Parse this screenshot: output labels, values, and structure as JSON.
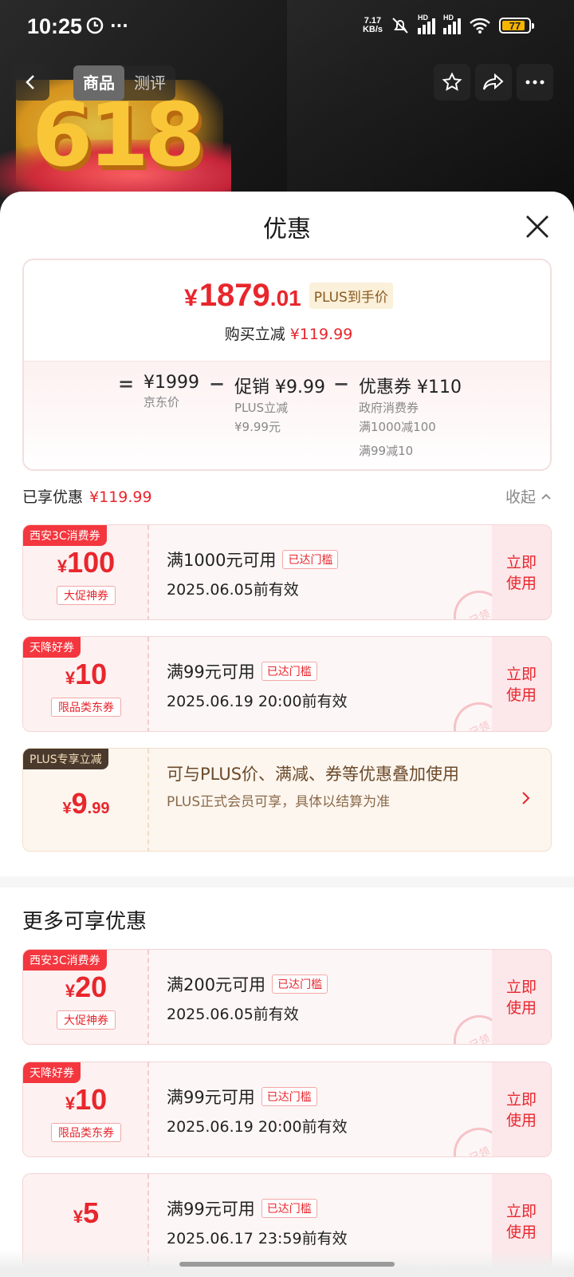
{
  "status": {
    "time": "10:25",
    "net_speed_top": "7.17",
    "net_speed_bottom": "KB/s",
    "hd1": "HD",
    "hd2": "HD",
    "battery": "77"
  },
  "nav": {
    "tabs": [
      "商品",
      "测评"
    ]
  },
  "sheet": {
    "title": "优惠",
    "summary": {
      "currency": "¥",
      "price_int": "1879",
      "price_dec": ".01",
      "plus_label": "PLUS到手价",
      "instant_label": "购买立减",
      "instant_amount": "¥119.99",
      "eq": "=",
      "minus": "−",
      "jd_price": "¥1999",
      "jd_price_label": "京东价",
      "promo": "促销 ¥9.99",
      "promo_sub1": "PLUS立减",
      "promo_sub2": "¥9.99元",
      "coupon": "优惠券 ¥110",
      "coupon_sub1": "政府消费券",
      "coupon_sub2": "满1000减100",
      "coupon_sub3": "满99减10"
    },
    "enjoyed": {
      "label": "已享优惠",
      "amount": "¥119.99",
      "collapse": "收起"
    },
    "coupons": [
      {
        "badge": "西安3C消费券",
        "currency": "¥",
        "value": "100",
        "type": "大促神券",
        "condition": "满1000元可用",
        "reached": "已达门槛",
        "valid": "2025.06.05前有效",
        "use": "立即使用",
        "stamp": "已领"
      },
      {
        "badge": "天降好券",
        "currency": "¥",
        "value": "10",
        "type": "限品类东券",
        "condition": "满99元可用",
        "reached": "已达门槛",
        "valid": "2025.06.19 20:00前有效",
        "use": "立即使用",
        "stamp": "已领"
      }
    ],
    "plus": {
      "badge": "PLUS专享立减",
      "currency": "¥",
      "value": "9",
      "dec": ".99",
      "desc": "可与PLUS价、满减、券等优惠叠加使用",
      "note": "PLUS正式会员可享，具体以结算为准"
    },
    "more": {
      "title": "更多可享优惠",
      "coupons": [
        {
          "badge": "西安3C消费券",
          "currency": "¥",
          "value": "20",
          "type": "大促神券",
          "condition": "满200元可用",
          "reached": "已达门槛",
          "valid": "2025.06.05前有效",
          "use": "立即使用",
          "stamp": "已领"
        },
        {
          "badge": "天降好券",
          "currency": "¥",
          "value": "10",
          "type": "限品类东券",
          "condition": "满99元可用",
          "reached": "已达门槛",
          "valid": "2025.06.19 20:00前有效",
          "use": "立即使用",
          "stamp": "已领"
        },
        {
          "badge": "",
          "currency": "¥",
          "value": "5",
          "type": "",
          "condition": "满99元可用",
          "reached": "已达门槛",
          "valid": "2025.06.17 23:59前有效",
          "use": "立即使用",
          "stamp": ""
        }
      ]
    }
  },
  "colors": {
    "accent_red": "#e8262d",
    "plus_brown": "#4a3a2e",
    "plus_gold": "#fbf0d9"
  }
}
